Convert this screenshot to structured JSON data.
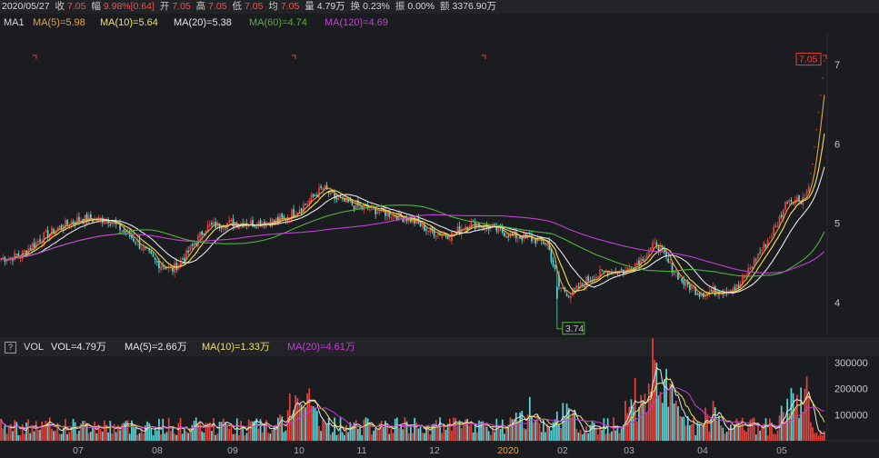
{
  "info": {
    "date": "2020/05/27",
    "close_label": "收",
    "close_value": "7.05",
    "change_label": "幅",
    "change_value": "9.98%[0.64]",
    "open_label": "开",
    "open_value": "7.05",
    "high_label": "高",
    "high_value": "7.05",
    "low_label": "低",
    "low_value": "7.05",
    "avg_label": "均",
    "avg_value": "7.05",
    "vol_label": "量",
    "vol_value": "4.79万",
    "turnover_label": "换",
    "turnover_value": "0.23%",
    "amp_label": "振",
    "amp_value": "0.00%",
    "amount_label": "额",
    "amount_value": "3376.90万"
  },
  "ma_legend": {
    "title": "MA1",
    "items": [
      {
        "text": "MA(5)=5.98",
        "color": "#e8a23a"
      },
      {
        "text": "MA(10)=5.64",
        "color": "#f2e15a"
      },
      {
        "text": "MA(20)=5.38",
        "color": "#e6e6e6"
      },
      {
        "text": "MA(60)=4.74",
        "color": "#4fb43c"
      },
      {
        "text": "MA(120)=4.69",
        "color": "#c43fd8"
      }
    ]
  },
  "vol_legend": {
    "help": "?",
    "title": "VOL",
    "items": [
      {
        "text": "VOL=4.79万",
        "color": "#e6e6e6"
      },
      {
        "text": "MA(5)=2.66万",
        "color": "#e6e6e6"
      },
      {
        "text": "MA(10)=1.33万",
        "color": "#f2e15a"
      },
      {
        "text": "MA(20)=4.61万",
        "color": "#c43fd8"
      }
    ]
  },
  "colors": {
    "up": "#e8413a",
    "down": "#5ed3d6",
    "ma5": "#e8a23a",
    "ma10": "#f2e15a",
    "ma20": "#e6e6e6",
    "ma60": "#4fb43c",
    "ma120": "#c43fd8"
  },
  "chart_data": {
    "type": "candlestick",
    "price_axis": {
      "ticks": [
        "7",
        "6",
        "5",
        "4"
      ],
      "range": [
        3.6,
        7.4
      ]
    },
    "volume_axis": {
      "ticks": [
        "300000",
        "200000",
        "100000"
      ],
      "range": [
        0,
        320000
      ]
    },
    "x_labels": [
      "07",
      "08",
      "09",
      "10",
      "11",
      "12",
      "2020",
      "02",
      "03",
      "04",
      "05"
    ],
    "x_label_highlight": "2020",
    "annotations": [
      {
        "text": "7.05",
        "kind": "high",
        "price": 7.05
      },
      {
        "text": "3.74",
        "kind": "low",
        "price": 3.74
      }
    ],
    "anchors": [
      [
        0,
        4.55
      ],
      [
        10,
        4.6
      ],
      [
        20,
        4.8
      ],
      [
        30,
        4.95
      ],
      [
        40,
        5.05
      ],
      [
        55,
        5.05
      ],
      [
        68,
        4.8
      ],
      [
        80,
        4.5
      ],
      [
        88,
        4.42
      ],
      [
        95,
        4.6
      ],
      [
        105,
        4.95
      ],
      [
        115,
        5.0
      ],
      [
        130,
        5.0
      ],
      [
        145,
        5.05
      ],
      [
        158,
        5.28
      ],
      [
        165,
        5.45
      ],
      [
        172,
        5.3
      ],
      [
        185,
        5.2
      ],
      [
        195,
        5.15
      ],
      [
        210,
        5.05
      ],
      [
        220,
        4.9
      ],
      [
        230,
        4.85
      ],
      [
        240,
        5.0
      ],
      [
        250,
        4.95
      ],
      [
        262,
        4.85
      ],
      [
        272,
        4.8
      ],
      [
        280,
        4.75
      ],
      [
        286,
        4.2
      ],
      [
        292,
        4.1
      ],
      [
        300,
        4.28
      ],
      [
        310,
        4.4
      ],
      [
        320,
        4.4
      ],
      [
        328,
        4.55
      ],
      [
        336,
        4.75
      ],
      [
        342,
        4.5
      ],
      [
        350,
        4.25
      ],
      [
        358,
        4.12
      ],
      [
        368,
        4.15
      ],
      [
        378,
        4.2
      ],
      [
        384,
        4.45
      ],
      [
        392,
        4.75
      ],
      [
        398,
        5.0
      ],
      [
        403,
        5.3
      ],
      [
        406,
        5.3
      ],
      [
        410,
        5.3
      ],
      [
        413,
        5.4
      ],
      [
        416,
        5.75
      ],
      [
        419,
        6.4
      ],
      [
        422,
        7.05
      ]
    ],
    "candle_count": 423
  }
}
